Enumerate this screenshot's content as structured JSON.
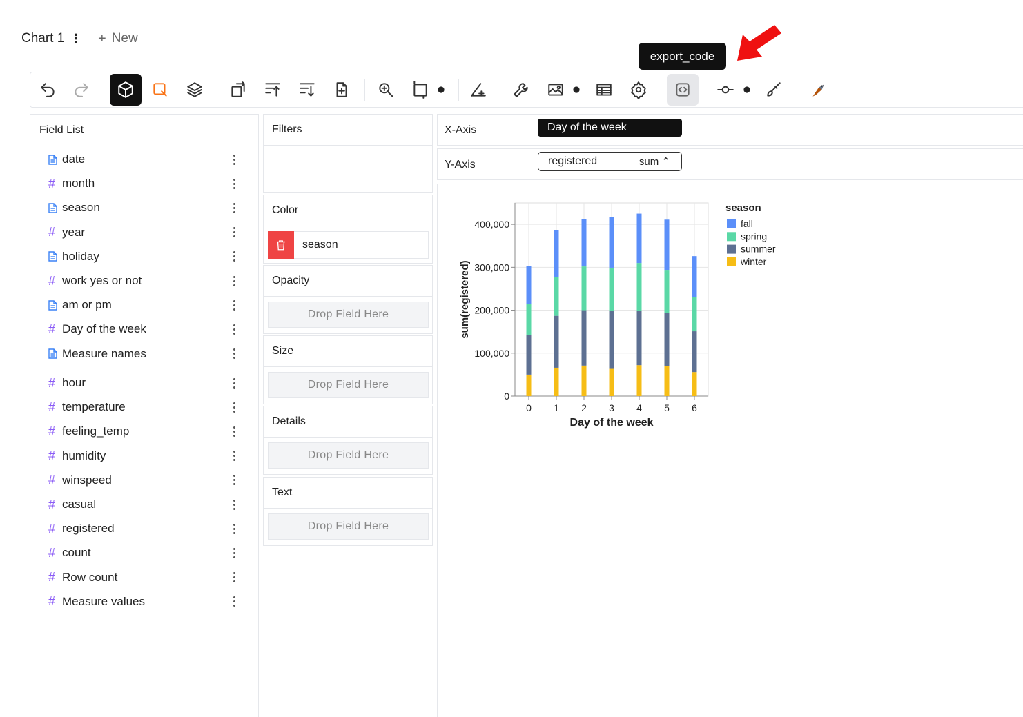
{
  "tabs": {
    "active_label": "Chart 1",
    "new_label": "New"
  },
  "tooltip": {
    "text": "export_code"
  },
  "toolbar": {
    "icons": [
      "undo-icon",
      "redo-icon",
      "cube-icon",
      "brush-icon",
      "layers-icon",
      "transpose-icon",
      "sort-asc-icon",
      "sort-desc-icon",
      "file-plus-icon",
      "zoom-icon",
      "resize-icon",
      "settings-small-icon",
      "axis-icon",
      "wrench-icon",
      "image-icon",
      "table-icon",
      "gear-icon",
      "code-icon",
      "link-icon",
      "painter-icon",
      "bird-logo-icon"
    ]
  },
  "field_list": {
    "title": "Field List",
    "dimensions": [
      {
        "name": "date",
        "type": "doc"
      },
      {
        "name": "month",
        "type": "hash"
      },
      {
        "name": "season",
        "type": "doc"
      },
      {
        "name": "year",
        "type": "hash"
      },
      {
        "name": "holiday",
        "type": "doc"
      },
      {
        "name": "work yes or not",
        "type": "hash"
      },
      {
        "name": "am or pm",
        "type": "doc"
      },
      {
        "name": "Day of the week",
        "type": "hash"
      },
      {
        "name": "Measure names",
        "type": "doc"
      }
    ],
    "measures": [
      {
        "name": "hour",
        "type": "hash"
      },
      {
        "name": "temperature",
        "type": "hash"
      },
      {
        "name": "feeling_temp",
        "type": "hash"
      },
      {
        "name": "humidity",
        "type": "hash"
      },
      {
        "name": "winspeed",
        "type": "hash"
      },
      {
        "name": "casual",
        "type": "hash"
      },
      {
        "name": "registered",
        "type": "hash"
      },
      {
        "name": "count",
        "type": "hash"
      },
      {
        "name": "Row count",
        "type": "hash"
      },
      {
        "name": "Measure values",
        "type": "hash"
      }
    ]
  },
  "panels": {
    "filters": "Filters",
    "color": "Color",
    "color_field": "season",
    "opacity": "Opacity",
    "size": "Size",
    "details": "Details",
    "text": "Text",
    "drop_placeholder": "Drop Field Here"
  },
  "axes": {
    "x_label": "X-Axis",
    "x_field": "Day of the week",
    "y_label": "Y-Axis",
    "y_field": "registered",
    "y_agg": "sum"
  },
  "colors": {
    "fall": "#5b8ff9",
    "spring": "#5ad8a6",
    "summer": "#5d7092",
    "winter": "#f6bd16",
    "delete": "#ef4444"
  },
  "chart_data": {
    "type": "bar",
    "stacked": true,
    "xlabel": "Day of the week",
    "ylabel": "sum(registered)",
    "legend_title": "season",
    "categories": [
      "0",
      "1",
      "2",
      "3",
      "4",
      "5",
      "6"
    ],
    "ylim": [
      0,
      450000
    ],
    "yticks": [
      0,
      100000,
      200000,
      300000,
      400000
    ],
    "ytick_labels": [
      "0",
      "100,000",
      "200,000",
      "300,000",
      "400,000"
    ],
    "legend_position": "right",
    "grid": true,
    "series": [
      {
        "name": "winter",
        "color": "#f6bd16",
        "values": [
          50000,
          66000,
          71000,
          65000,
          72000,
          70000,
          56000
        ]
      },
      {
        "name": "summer",
        "color": "#5d7092",
        "values": [
          93000,
          121000,
          129000,
          134000,
          127000,
          124000,
          95000
        ]
      },
      {
        "name": "spring",
        "color": "#5ad8a6",
        "values": [
          71000,
          90000,
          102000,
          100000,
          111000,
          100000,
          79000
        ]
      },
      {
        "name": "fall",
        "color": "#5b8ff9",
        "values": [
          89000,
          110000,
          111000,
          118000,
          115000,
          117000,
          96000
        ]
      }
    ],
    "legend_order": [
      "fall",
      "spring",
      "summer",
      "winter"
    ]
  }
}
